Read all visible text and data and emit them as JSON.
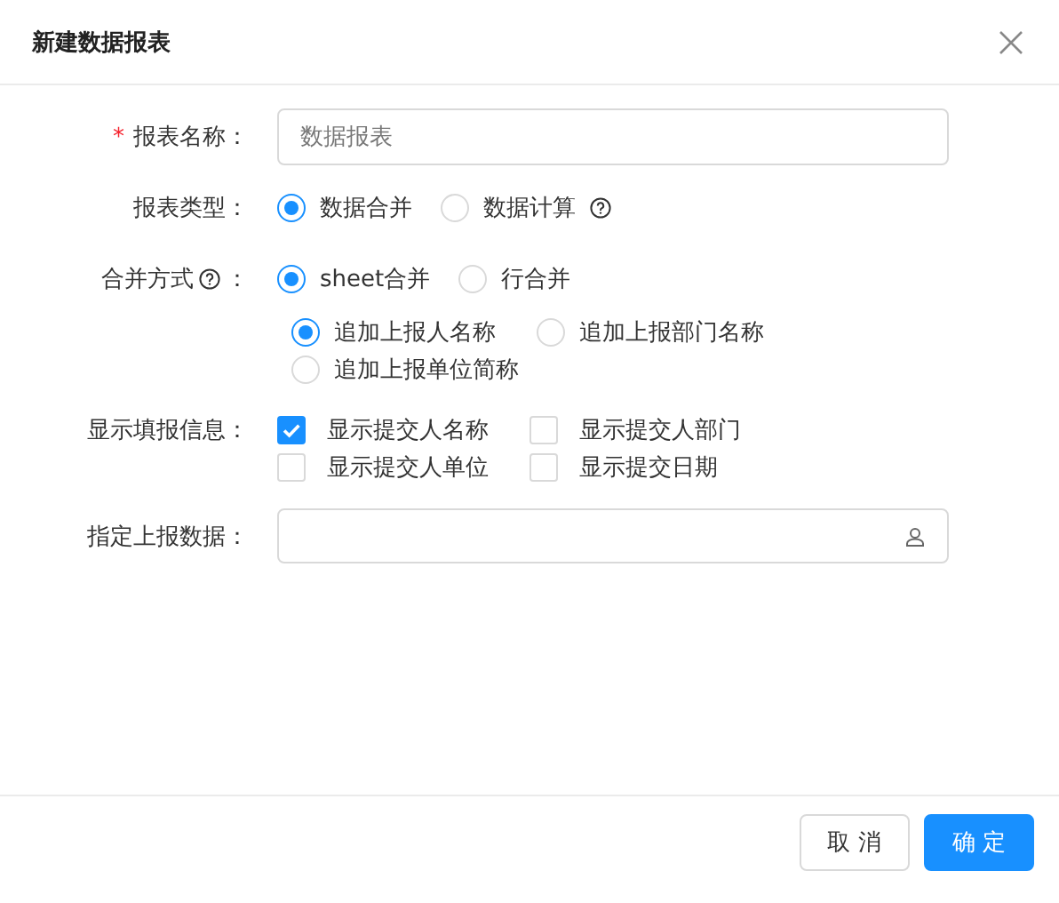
{
  "dialog": {
    "title": "新建数据报表"
  },
  "fields": [
    {
      "kind": "text",
      "required_mark": "*",
      "label": "报表名称：",
      "placeholder": "数据报表"
    },
    {
      "kind": "radio",
      "label": "报表类型：",
      "options": [
        {
          "label": "数据合并",
          "selected": true,
          "help": false
        },
        {
          "label": "数据计算",
          "selected": false,
          "help": true
        }
      ]
    },
    {
      "kind": "radio",
      "label": "合并方式",
      "help": true,
      "suffix": "：",
      "options": [
        {
          "label": "sheet合并",
          "selected": true,
          "help": false
        },
        {
          "label": "行合并",
          "selected": false,
          "help": false
        }
      ],
      "sub_options": [
        {
          "label": "追加上报人名称",
          "selected": true
        },
        {
          "label": "追加上报部门名称",
          "selected": false
        },
        {
          "label": "追加上报单位简称",
          "selected": false
        }
      ]
    },
    {
      "kind": "checkbox",
      "label": "显示填报信息：",
      "options": [
        {
          "label": "显示提交人名称",
          "checked": true
        },
        {
          "label": "显示提交人部门",
          "checked": false
        },
        {
          "label": "显示提交人单位",
          "checked": false
        },
        {
          "label": "显示提交日期",
          "checked": false
        }
      ]
    },
    {
      "kind": "picker",
      "label": "指定上报数据："
    }
  ],
  "buttons": [
    {
      "label": "取 消",
      "kind": "secondary"
    },
    {
      "label": "确 定",
      "kind": "primary"
    }
  ]
}
